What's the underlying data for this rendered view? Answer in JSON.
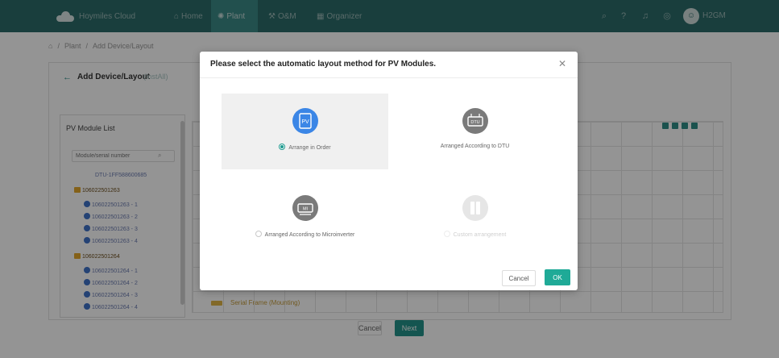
{
  "app": {
    "brand": "Hoymiles Cloud"
  },
  "nav": {
    "items": [
      {
        "label": "Home",
        "icon": "home-icon"
      },
      {
        "label": "Plant",
        "icon": "plant-icon",
        "active": true
      },
      {
        "label": "O&M",
        "icon": "wrench-icon"
      },
      {
        "label": "Organizer",
        "icon": "organizer-icon"
      }
    ]
  },
  "toolbar": {
    "icons": [
      "search-icon",
      "help-icon",
      "bell-icon",
      "globe-icon"
    ],
    "user": "H2GM"
  },
  "breadcrumb": {
    "items": [
      "Plant",
      "Add Device/Layout"
    ]
  },
  "page": {
    "title": "Add Device/Layout",
    "subtitle": "(InstAll)",
    "module_list_title": "PV Module List",
    "search_placeholder": "Module/serial number",
    "tree": [
      {
        "label": "DTU-1FF588600685",
        "type": "dtu"
      },
      {
        "label": "106022501263",
        "type": "group"
      },
      {
        "label": "106022501263 - 1",
        "type": "module"
      },
      {
        "label": "106022501263 - 2",
        "type": "module"
      },
      {
        "label": "106022501263 - 3",
        "type": "module"
      },
      {
        "label": "106022501263 - 4",
        "type": "module"
      },
      {
        "label": "106022501264",
        "type": "group"
      },
      {
        "label": "106022501264 - 1",
        "type": "module"
      },
      {
        "label": "106022501264 - 2",
        "type": "module"
      },
      {
        "label": "106022501264 - 3",
        "type": "module"
      },
      {
        "label": "106022501264 - 4",
        "type": "module"
      }
    ],
    "legend_label": "Serial Frame (Mounting)",
    "cancel_label": "Cancel",
    "next_label": "Next"
  },
  "modal": {
    "title": "Please select the automatic layout method for PV Modules.",
    "options": [
      {
        "label": "Arrange in Order",
        "icon": "pv-panel-icon",
        "icon_text": "PV",
        "selected": true,
        "disabled": false
      },
      {
        "label": "Arranged According to DTU",
        "icon": "dtu-icon",
        "icon_text": "DTU",
        "selected": false,
        "disabled": false
      },
      {
        "label": "Arranged According to Microinverter",
        "icon": "microinverter-icon",
        "icon_text": "MI",
        "selected": false,
        "disabled": false
      },
      {
        "label": "Custom arrangement",
        "icon": "custom-layout-icon",
        "icon_text": "",
        "selected": false,
        "disabled": true
      }
    ],
    "cancel_label": "Cancel",
    "ok_label": "OK"
  },
  "colors": {
    "topbar": "#2c6b69",
    "accent": "#1faa97",
    "option_pv": "#3b86e6",
    "option_gray": "#7a7a7a"
  }
}
